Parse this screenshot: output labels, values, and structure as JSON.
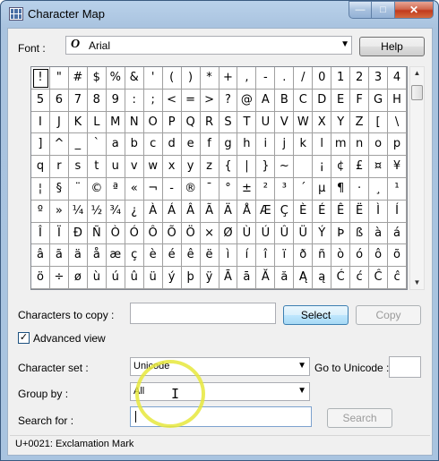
{
  "window": {
    "title": "Character Map"
  },
  "title_buttons": {
    "minimize": "—",
    "maximize": "□",
    "close": "✕"
  },
  "font": {
    "label": "Font :",
    "value": "Arial",
    "icon": "opentype-font-icon"
  },
  "help_label": "Help",
  "characters": [
    "!",
    "\"",
    "#",
    "$",
    "%",
    "&",
    "'",
    "(",
    ")",
    "*",
    "+",
    ",",
    "-",
    ".",
    "/",
    "0",
    "1",
    "2",
    "3",
    "4",
    "5",
    "6",
    "7",
    "8",
    "9",
    ":",
    ";",
    "<",
    "=",
    ">",
    "?",
    "@",
    "A",
    "B",
    "C",
    "D",
    "E",
    "F",
    "G",
    "H",
    "I",
    "J",
    "K",
    "L",
    "M",
    "N",
    "O",
    "P",
    "Q",
    "R",
    "S",
    "T",
    "U",
    "V",
    "W",
    "X",
    "Y",
    "Z",
    "[",
    "\\",
    "]",
    "^",
    "_",
    "`",
    "a",
    "b",
    "c",
    "d",
    "e",
    "f",
    "g",
    "h",
    "i",
    "j",
    "k",
    "l",
    "m",
    "n",
    "o",
    "p",
    "q",
    "r",
    "s",
    "t",
    "u",
    "v",
    "w",
    "x",
    "y",
    "z",
    "{",
    "|",
    "}",
    "~",
    " ",
    "¡",
    "¢",
    "£",
    "¤",
    "¥",
    "¦",
    "§",
    "¨",
    "©",
    "ª",
    "«",
    "¬",
    "-",
    "®",
    "¯",
    "°",
    "±",
    "²",
    "³",
    "´",
    "µ",
    "¶",
    "·",
    "¸",
    "¹",
    "º",
    "»",
    "¼",
    "½",
    "¾",
    "¿",
    "À",
    "Á",
    "Â",
    "Ã",
    "Ä",
    "Å",
    "Æ",
    "Ç",
    "È",
    "É",
    "Ê",
    "Ë",
    "Ì",
    "Í",
    "Î",
    "Ï",
    "Ð",
    "Ñ",
    "Ò",
    "Ó",
    "Ô",
    "Õ",
    "Ö",
    "×",
    "Ø",
    "Ù",
    "Ú",
    "Û",
    "Ü",
    "Ý",
    "Þ",
    "ß",
    "à",
    "á",
    "â",
    "ã",
    "ä",
    "å",
    "æ",
    "ç",
    "è",
    "é",
    "ê",
    "ë",
    "ì",
    "í",
    "î",
    "ï",
    "ð",
    "ñ",
    "ò",
    "ó",
    "ô",
    "õ",
    "ö",
    "÷",
    "ø",
    "ù",
    "ú",
    "û",
    "ü",
    "ý",
    "þ",
    "ÿ",
    "Ā",
    "ā",
    "Ă",
    "ă",
    "Ą",
    "ą",
    "Ć",
    "ć",
    "Ĉ",
    "ĉ"
  ],
  "selected_character_index": 0,
  "scroll": {
    "up": "▲",
    "down": "▼"
  },
  "copy": {
    "label": "Characters to copy :",
    "value": "",
    "select_label": "Select",
    "copy_label": "Copy"
  },
  "advanced_view": {
    "label": "Advanced view",
    "checked": true,
    "mark": "✓"
  },
  "character_set": {
    "label": "Character set :",
    "value": "Unicode"
  },
  "go_to_unicode": {
    "label": "Go to Unicode :",
    "value": ""
  },
  "group_by": {
    "label": "Group by :",
    "value": "All"
  },
  "search": {
    "label": "Search for :",
    "value": "",
    "button": "Search"
  },
  "status": "U+0021: Exclamation Mark",
  "colors": {
    "title_bar": "#b9d1ea",
    "close_button": "#c23a1c",
    "select_button": "#bee6fd",
    "highlight_ring": "#e6e83c"
  }
}
